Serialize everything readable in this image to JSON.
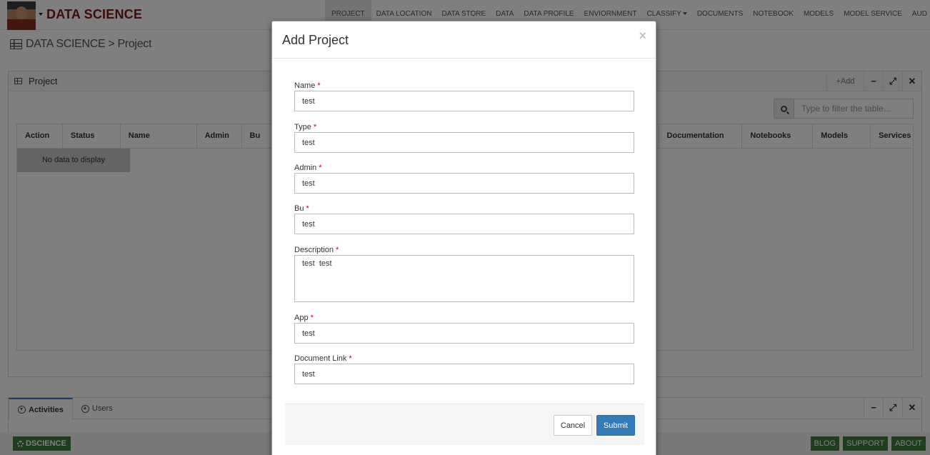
{
  "app": {
    "brand": "DATA SCIENCE"
  },
  "nav": {
    "items": [
      {
        "label": "PROJECT",
        "active": true,
        "has_menu": false
      },
      {
        "label": "DATA LOCATION",
        "active": false,
        "has_menu": false
      },
      {
        "label": "DATA STORE",
        "active": false,
        "has_menu": false
      },
      {
        "label": "DATA",
        "active": false,
        "has_menu": false
      },
      {
        "label": "DATA PROFILE",
        "active": false,
        "has_menu": false
      },
      {
        "label": "ENVIORNMENT",
        "active": false,
        "has_menu": false
      },
      {
        "label": "CLASSIFY",
        "active": false,
        "has_menu": true
      },
      {
        "label": "DOCUMENTS",
        "active": false,
        "has_menu": false
      },
      {
        "label": "NOTEBOOK",
        "active": false,
        "has_menu": false
      },
      {
        "label": "MODELS",
        "active": false,
        "has_menu": false
      },
      {
        "label": "MODEL SERVICE",
        "active": false,
        "has_menu": false
      },
      {
        "label": "AUD",
        "active": false,
        "has_menu": false
      }
    ]
  },
  "breadcrumb": {
    "root": "DATA SCIENCE",
    "separator": ">",
    "current": "Project"
  },
  "project_panel": {
    "title": "Project",
    "add_label": "Add",
    "filter_placeholder": "Type to filter the table...",
    "columns": [
      {
        "label": "Action"
      },
      {
        "label": "Status"
      },
      {
        "label": "Name"
      },
      {
        "label": "Admin"
      },
      {
        "label": "Bu"
      },
      {
        "label": ""
      },
      {
        "label": "Documentation"
      },
      {
        "label": "Notebooks"
      },
      {
        "label": "Models"
      },
      {
        "label": "Services"
      }
    ],
    "empty_text": "No data to display"
  },
  "activity_panel": {
    "tabs": [
      {
        "label": "Activities",
        "icon": "download-circle-icon",
        "active": true
      },
      {
        "label": "Users",
        "icon": "upload-circle-icon",
        "active": false
      }
    ]
  },
  "footer": {
    "brand": "DSCIENCE",
    "links": [
      "BLOG",
      "SUPPORT",
      "ABOUT"
    ]
  },
  "modal": {
    "title": "Add Project",
    "close_glyph": "×",
    "required_marker": "*",
    "fields": {
      "name": {
        "label": "Name",
        "value": "test"
      },
      "type": {
        "label": "Type",
        "value": "test"
      },
      "admin": {
        "label": "Admin",
        "value": "test"
      },
      "bu": {
        "label": "Bu",
        "value": "test"
      },
      "description": {
        "label": "Description",
        "value": "test  test"
      },
      "app": {
        "label": "App",
        "value": "test"
      },
      "document_link": {
        "label": "Document Link",
        "value": "test"
      }
    },
    "cancel_label": "Cancel",
    "submit_label": "Submit"
  },
  "colors": {
    "brand_text": "#7a1a14",
    "primary": "#337ab7",
    "required": "#cc0000",
    "footer_green": "#3c7d3a"
  }
}
